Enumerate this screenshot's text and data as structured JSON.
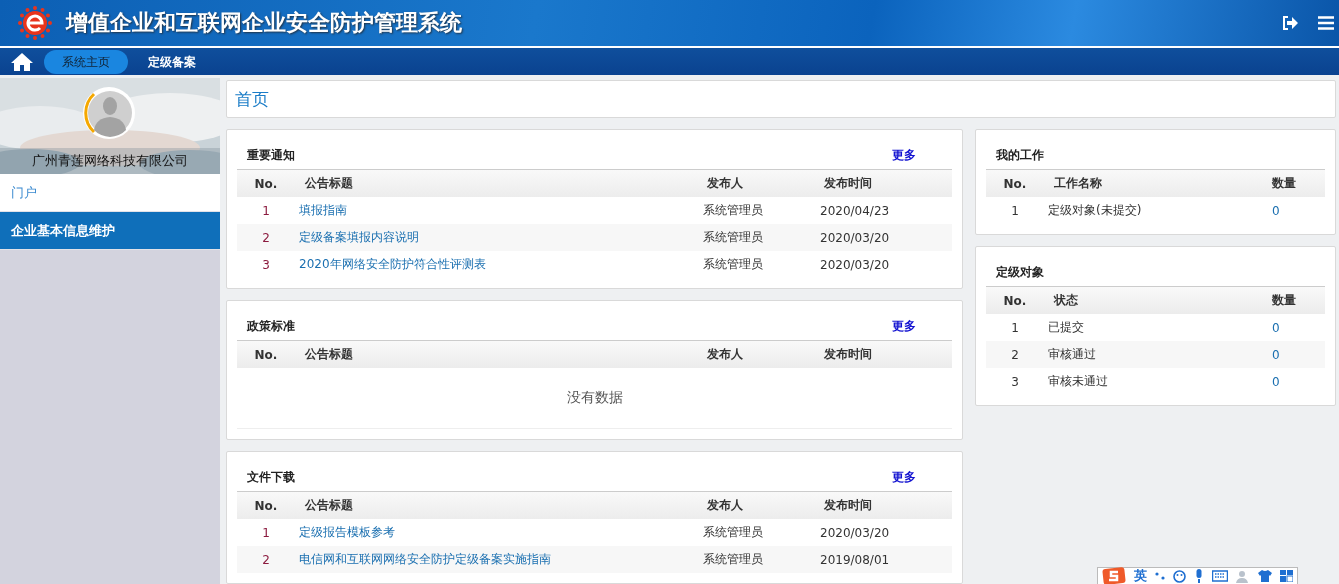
{
  "header": {
    "title": "增值企业和互联网企业安全防护管理系统"
  },
  "nav": {
    "tabs": [
      {
        "label": "系统主页",
        "selected": true
      },
      {
        "label": "定级备案",
        "selected": false
      }
    ]
  },
  "sidebar": {
    "company": "广州青莲网络科技有限公司",
    "items": [
      {
        "label": "门户",
        "selected": false
      },
      {
        "label": "企业基本信息维护",
        "selected": true
      }
    ]
  },
  "page_title": "首页",
  "left_panels": [
    {
      "title": "重要通知",
      "more": "更多",
      "columns": [
        "No.",
        "公告标题",
        "发布人",
        "发布时间"
      ],
      "rows": [
        {
          "no": "1",
          "title": "填报指南",
          "publisher": "系统管理员",
          "date": "2020/04/23"
        },
        {
          "no": "2",
          "title": "定级备案填报内容说明",
          "publisher": "系统管理员",
          "date": "2020/03/20"
        },
        {
          "no": "3",
          "title": "2020年网络安全防护符合性评测表",
          "publisher": "系统管理员",
          "date": "2020/03/20"
        }
      ]
    },
    {
      "title": "政策标准",
      "more": "更多",
      "columns": [
        "No.",
        "公告标题",
        "发布人",
        "发布时间"
      ],
      "empty": "没有数据"
    },
    {
      "title": "文件下载",
      "more": "更多",
      "columns": [
        "No.",
        "公告标题",
        "发布人",
        "发布时间"
      ],
      "rows": [
        {
          "no": "1",
          "title": "定级报告模板参考",
          "publisher": "系统管理员",
          "date": "2020/03/20"
        },
        {
          "no": "2",
          "title": "电信网和互联网网络安全防护定级备案实施指南",
          "publisher": "系统管理员",
          "date": "2019/08/01"
        }
      ]
    }
  ],
  "right_panels": [
    {
      "title": "我的工作",
      "columns": [
        "No.",
        "工作名称",
        "数量"
      ],
      "rows": [
        {
          "no": "1",
          "name": "定级对象(未提交)",
          "count": "0"
        }
      ]
    },
    {
      "title": "定级对象",
      "columns": [
        "No.",
        "状态",
        "数量"
      ],
      "rows": [
        {
          "no": "1",
          "name": "已提交",
          "count": "0"
        },
        {
          "no": "2",
          "name": "审核通过",
          "count": "0"
        },
        {
          "no": "3",
          "name": "审核未通过",
          "count": "0"
        }
      ]
    }
  ],
  "ime_toolbar": {
    "mode": "英"
  }
}
